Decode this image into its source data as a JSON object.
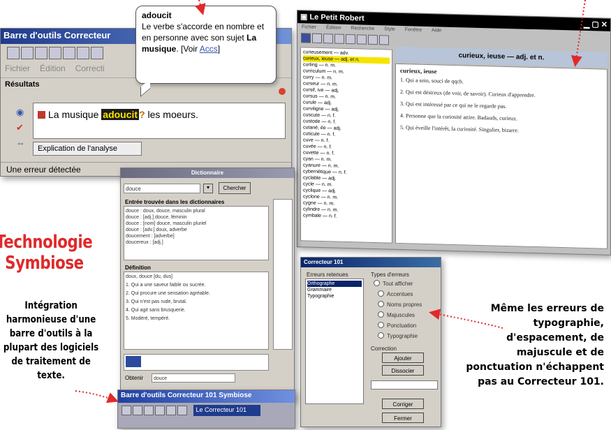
{
  "correcteur_window": {
    "title": "Barre d'outils Correcteur",
    "menu": [
      "Fichier",
      "Édition",
      "Correcti"
    ],
    "results_label": "Résultats",
    "sentence_before": "La musique ",
    "error_word": "adoucit",
    "sentence_after": " les moeurs.",
    "tab_label": "Explication de l'analyse",
    "status": "Une erreur détectée"
  },
  "tooltip": {
    "word": "adoucit",
    "text": "Le verbe s'accorde en nombre et en personne avec son sujet",
    "subject": "La musique",
    "link_prefix": ". [Voir",
    "link": "Accs",
    "link_suffix": "]"
  },
  "dictionary_window": {
    "title": "Le Petit Robert",
    "headword": "curieux, ieuse — adj. et n.",
    "list": [
      "curieusement — adv.",
      "curieux, ieuse — adj. et n.",
      "curling — n. m.",
      "curriculum — n. m.",
      "curry — n. m.",
      "curseur — n. m.",
      "cursif, ive — adj.",
      "cursus — n. m.",
      "curule — adj.",
      "curviligne — adj.",
      "cuscute — n. f.",
      "custode — n. f.",
      "cutané, ée — adj.",
      "cuticule — n. f.",
      "cuve — n. f.",
      "cuvée — n. f.",
      "cuvette — n. f.",
      "cyan — n. m.",
      "cyanure — n. m.",
      "cybernétique — n. f.",
      "cyclable — adj.",
      "cycle — n. m.",
      "cyclique — adj.",
      "cyclone — n. m.",
      "cygne — n. m.",
      "cylindre — n. m.",
      "cymbale — n. f."
    ],
    "entry_headword": "curieux, ieuse",
    "entry_lines": [
      "1. Qui a soin, souci de qqch.",
      "2. Qui est désireux (de voir, de savoir). Curieux d'apprendre.",
      "3. Qui est intéressé par ce qui ne le regarde pas.",
      "4. Personne que la curiosité attire. Badauds, curieux.",
      "5. Qui éveille l'intérêt, la curiosité. Singulier, bizarre."
    ]
  },
  "search_window": {
    "title": "Dictionnaire",
    "search_value": "douce",
    "search_button": "Chercher",
    "results_label": "Entrée trouvée dans les dictionnaires",
    "definition_label": "Définition",
    "results": [
      "douce : doux, douce, masculin plural",
      "douce : [adj.] douce, féminin",
      "douce : [nom] douce, masculin pluriel",
      "douce : [adv.] doux, adverbe",
      "doucement : [adverbe]",
      "doucereux : [adj.]"
    ],
    "definition_lines": [
      "doux, douce [du, dus]",
      "1. Qui a une saveur faible ou sucrée.",
      "2. Qui procure une sensation agréable.",
      "3. Qui n'est pas rude, brutal.",
      "4. Qui agit sans brusquerie.",
      "5. Modéré, tempéré."
    ],
    "footer_label": "Obtenir",
    "footer_value": "douce"
  },
  "bottom_toolbar": {
    "title": "Barre d'outils Correcteur 101 Symbiose",
    "combo": "Le Correcteur 101"
  },
  "options_window": {
    "title": "Correcteur 101",
    "left_label": "Erreurs retenues",
    "left_items": [
      "Orthographe",
      "Grammaire",
      "Typographie"
    ],
    "right_label": "Types d'erreurs",
    "radios": [
      "Tout afficher",
      "Accentues",
      "Noms propres",
      "Majuscules",
      "Ponctuation",
      "Typographie"
    ],
    "section_label": "Correction",
    "btn_apply": "Ajouter",
    "btn_dismiss": "Dissocier",
    "btn_correct": "Corriger",
    "btn_close": "Fermer"
  },
  "captions": {
    "title_line1": "Technologie",
    "title_line2": "Symbiose",
    "body": "Intégration harmonieuse d'une barre d'outils à la plupart des logiciels de traitement de texte.",
    "right": "Même les erreurs de typographie, d'espacement, de majuscule et de ponctuation n'échappent pas au Correcteur 101."
  },
  "colors": {
    "accent_red": "#e0292a",
    "highlight_yellow": "#ffe400",
    "title_blue": "#1f3b8c"
  }
}
